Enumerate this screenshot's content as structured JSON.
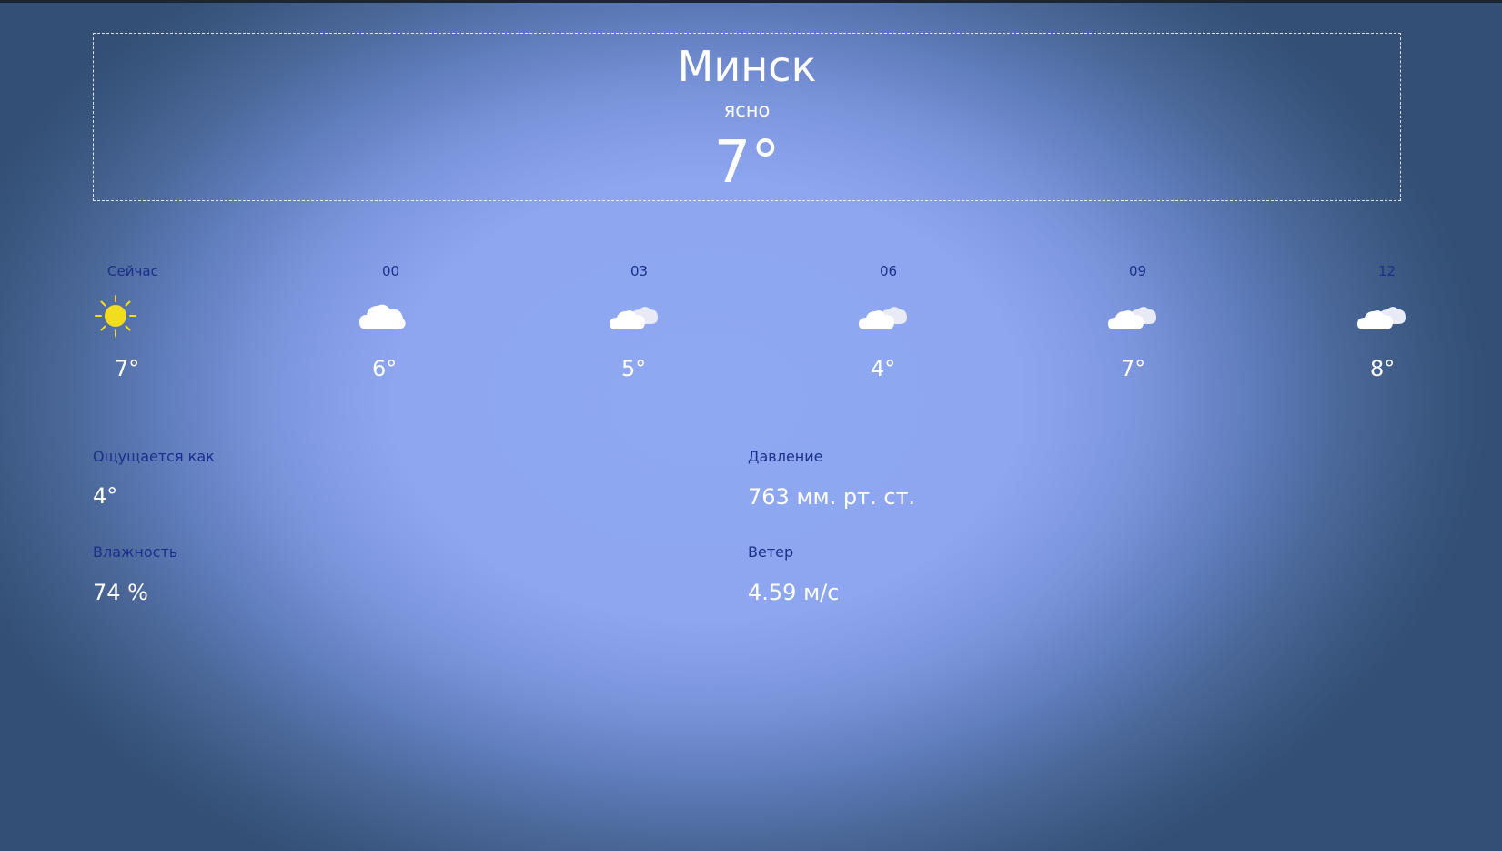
{
  "current": {
    "city": "Минск",
    "condition": "ясно",
    "temperature": "7°"
  },
  "hourly": [
    {
      "time": "Сейчас",
      "icon": "sun-icon",
      "temp": "7°"
    },
    {
      "time": "00",
      "icon": "cloud-icon",
      "temp": "6°"
    },
    {
      "time": "03",
      "icon": "clouds-icon",
      "temp": "5°"
    },
    {
      "time": "06",
      "icon": "clouds-icon",
      "temp": "4°"
    },
    {
      "time": "09",
      "icon": "clouds-icon",
      "temp": "7°"
    },
    {
      "time": "12",
      "icon": "clouds-icon",
      "temp": "8°"
    }
  ],
  "details": {
    "feels_like": {
      "label": "Ощущается как",
      "value": "4°"
    },
    "pressure": {
      "label": "Давление",
      "value": "763 мм. рт. ст."
    },
    "humidity": {
      "label": "Влажность",
      "value": "74 %"
    },
    "wind": {
      "label": "Ветер",
      "value": "4.59 м/с"
    }
  },
  "colors": {
    "label": "#1c2f8a",
    "sun": "#f2dc1f",
    "cloud": "#ffffff"
  }
}
